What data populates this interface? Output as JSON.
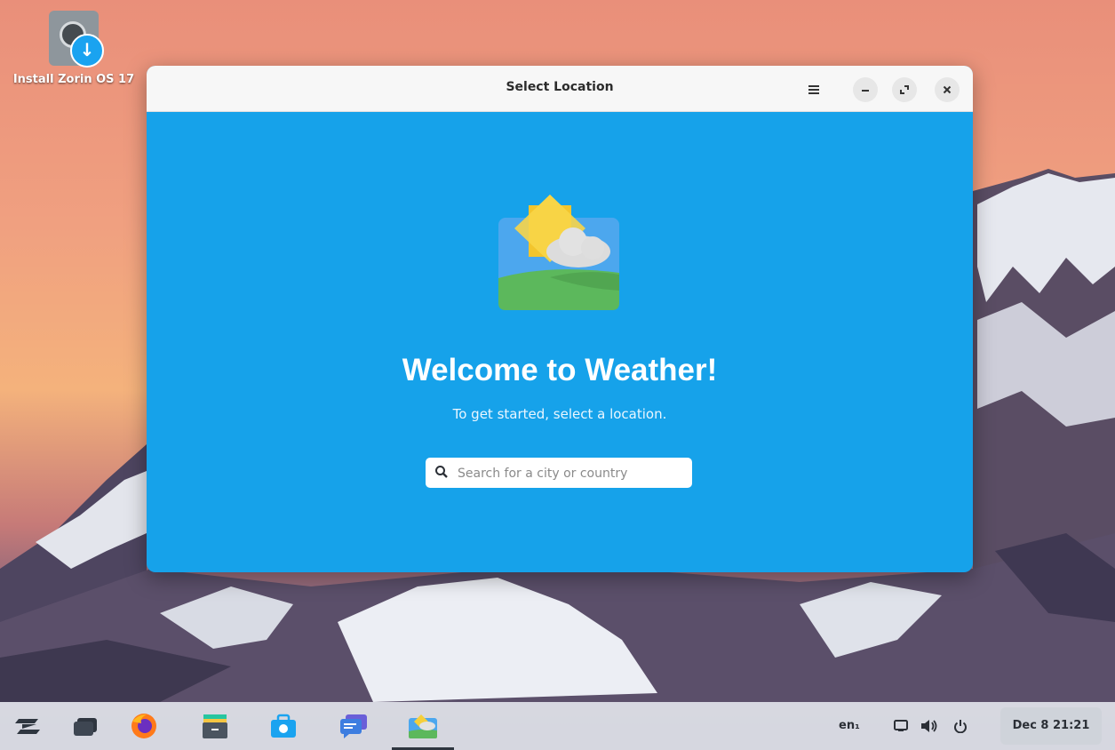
{
  "desktop": {
    "icon_label": "Install Zorin OS 17"
  },
  "window": {
    "title": "Select Location",
    "controls": {
      "menu_icon": "hamburger-menu-icon",
      "minimize_icon": "minimize-icon",
      "maximize_icon": "maximize-icon",
      "close_icon": "close-icon"
    },
    "welcome_heading": "Welcome to Weather!",
    "welcome_subtitle": "To get started, select a location.",
    "search": {
      "placeholder": "Search for a city or country",
      "value": ""
    },
    "colors": {
      "background": "#16a2ea",
      "titlebar": "#f7f7f7"
    }
  },
  "taskbar": {
    "apps": [
      {
        "name": "zorin-menu",
        "icon": "zorin-logo-icon"
      },
      {
        "name": "workspaces",
        "icon": "workspace-switcher-icon"
      },
      {
        "name": "firefox",
        "icon": "firefox-icon"
      },
      {
        "name": "files",
        "icon": "files-icon"
      },
      {
        "name": "software",
        "icon": "software-store-icon"
      },
      {
        "name": "messages",
        "icon": "chat-icon"
      },
      {
        "name": "weather",
        "icon": "weather-icon",
        "active": true
      }
    ],
    "keyboard_layout": "en₁",
    "tray_icons": [
      "screen-icon",
      "volume-icon",
      "power-icon"
    ],
    "clock": "Dec 8  21:21"
  }
}
